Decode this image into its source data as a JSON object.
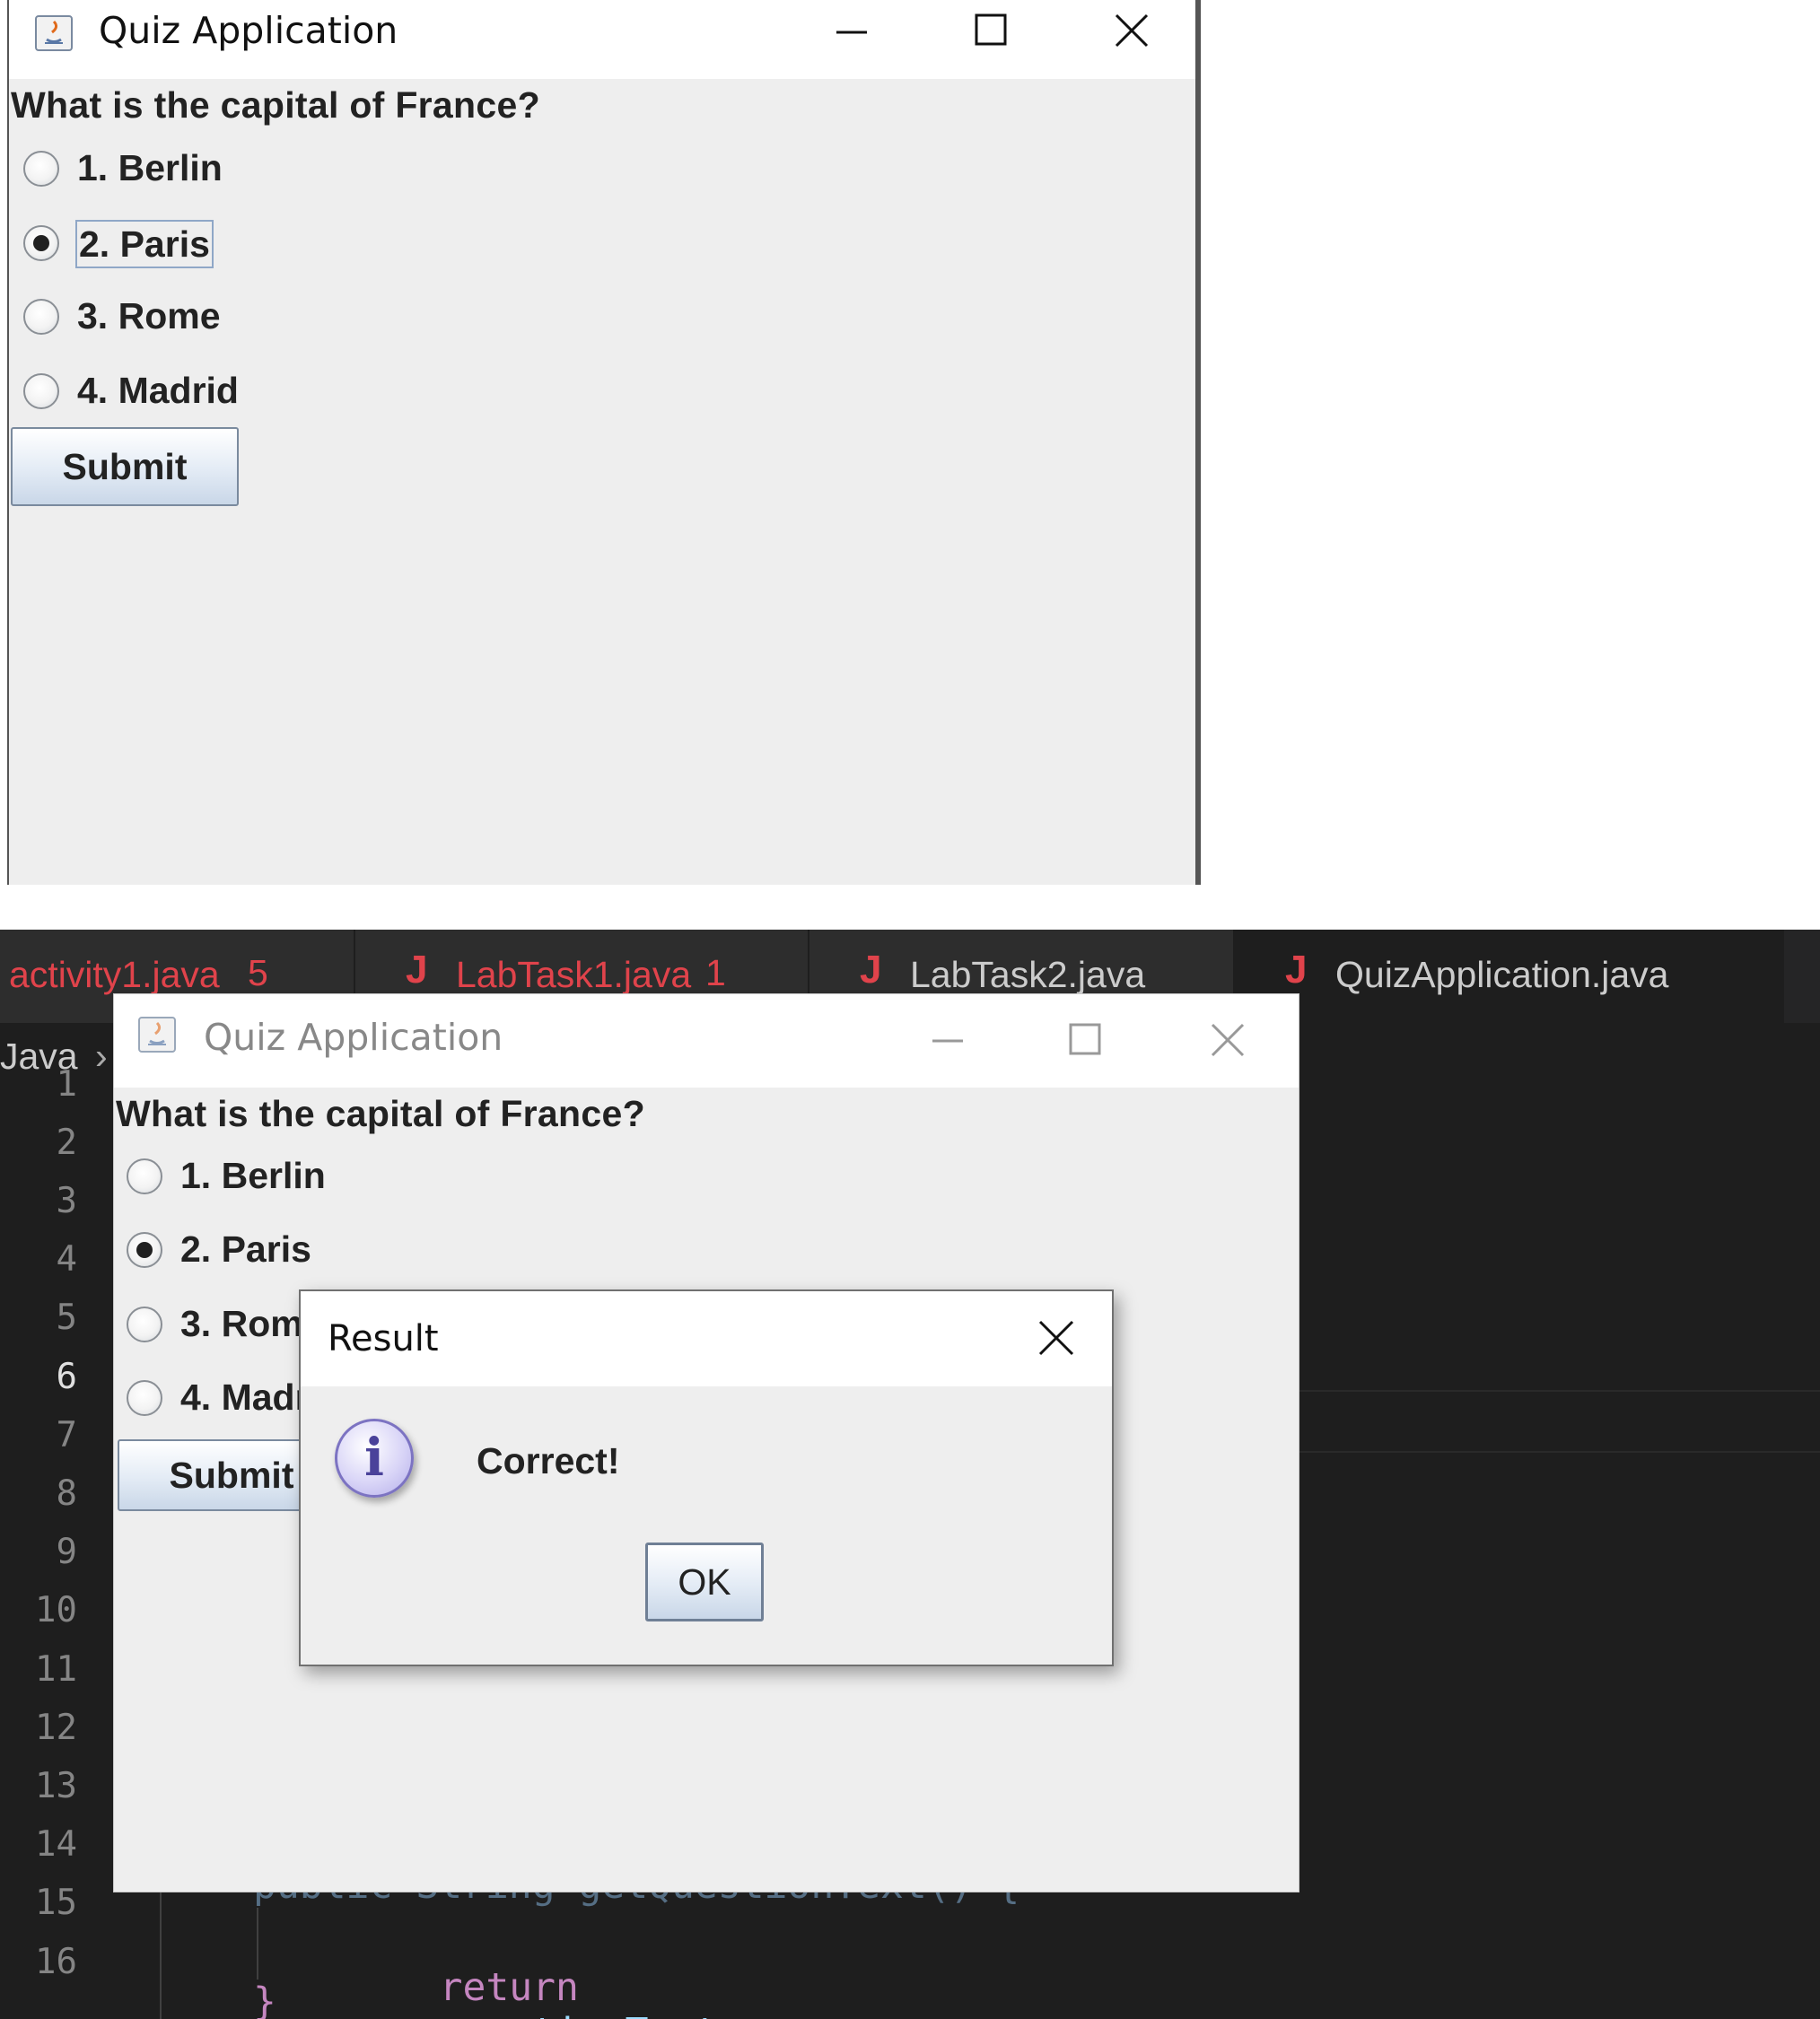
{
  "top_window": {
    "title": "Quiz Application",
    "question": "What is the capital of France?",
    "options": [
      "1. Berlin",
      "2. Paris",
      "3. Rome",
      "4. Madrid"
    ],
    "selected_index": 1,
    "submit_label": "Submit"
  },
  "ide": {
    "tabs": [
      {
        "name": "activity1.java",
        "problems": "5"
      },
      {
        "name": "LabTask1.java",
        "problems": "1"
      },
      {
        "name": "LabTask2.java",
        "problems": ""
      },
      {
        "name": "QuizApplication.java",
        "problems": ""
      }
    ],
    "breadcrumb": "Java",
    "line_numbers": [
      "1",
      "2",
      "3",
      "4",
      "5",
      "6",
      "7",
      "8",
      "9",
      "10",
      "11",
      "12",
      "13",
      "14",
      "15",
      "16"
    ],
    "current_line": "6",
    "code_partial_line": "public String getQuestionText() {",
    "code_line_15_kw": "return",
    "code_line_15_id": "questionText",
    "code_line_15_end": ";",
    "code_line_16": "}"
  },
  "bottom_window": {
    "title": "Quiz Application",
    "question": "What is the capital of France?",
    "options": [
      "1. Berlin",
      "2. Paris",
      "3. Rom",
      "4. Madr"
    ],
    "selected_index": 1,
    "submit_label": "Submit"
  },
  "dialog": {
    "title": "Result",
    "message": "Correct!",
    "ok_label": "OK",
    "icon_glyph": "i"
  },
  "icons": {
    "app": "java-app-icon",
    "info": "information-icon"
  },
  "colors": {
    "window_bg": "#eeeeee",
    "ide_bg": "#1e1e1e",
    "tab_error": "#e0434b",
    "keyword": "#c586c0",
    "identifier": "#9cdcfe"
  }
}
